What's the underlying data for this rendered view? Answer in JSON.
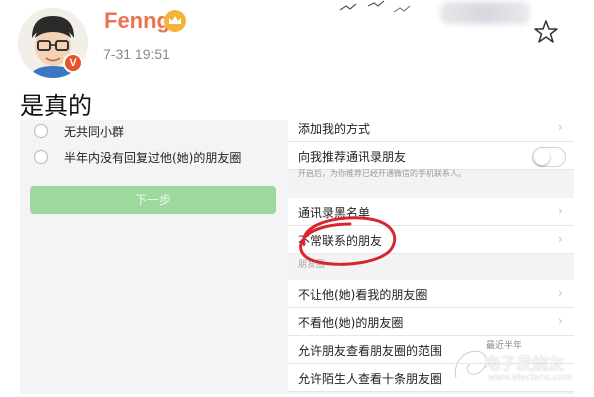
{
  "post": {
    "username": "Fenng",
    "time": "7-31 19:51",
    "verified_badge": "V",
    "text": "是真的"
  },
  "left_options": [
    {
      "label": "无共同小群"
    },
    {
      "label": "半年内没有回复过他(她)的朋友圈"
    }
  ],
  "next_button": "下一步",
  "settings": {
    "add_me_ways": "添加我的方式",
    "recommend_contacts": "向我推荐通讯录朋友",
    "hint": "开启后，为你推荐已经开通微信的手机联系人。",
    "blacklist": "通讯录黑名单",
    "infrequent_friends": "不常联系的朋友",
    "moments_section": "朋友圈",
    "dont_let_see": "不让他(她)看我的朋友圈",
    "dont_see": "不看他(她)的朋友圈",
    "allow_range": "允许朋友查看朋友圈的范围",
    "allow_range_value": "最近半年",
    "allow_strangers": "允许陌生人查看十条朋友圈"
  },
  "watermark": {
    "text": "电子发烧友",
    "url": "www.elecfans.com"
  },
  "colors": {
    "username": "#eb7350",
    "green_button": "#9ed89e",
    "annotation_red": "#d8262d"
  },
  "icons": [
    "avatar",
    "crown-icon",
    "star-icon",
    "chevron-right-icon",
    "toggle-switch",
    "birds-icon"
  ]
}
